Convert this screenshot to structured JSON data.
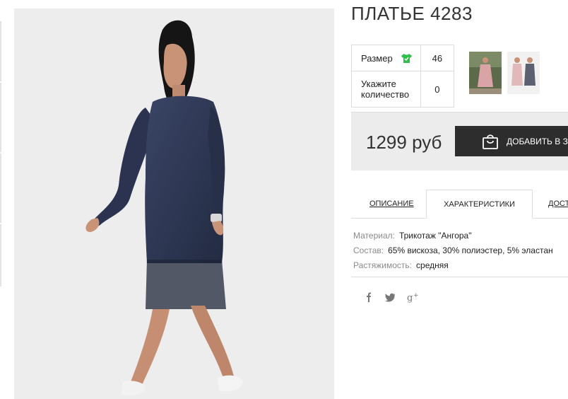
{
  "product": {
    "title": "ПЛАТЬЕ 4283",
    "image_alt": "Model wearing navy knit dress with tulle hem"
  },
  "options": {
    "size_label": "Размер",
    "size_value": "46",
    "qty_label_1": "Укажите",
    "qty_label_2": "количество",
    "qty_value": "0"
  },
  "purchase": {
    "price": "1299 руб",
    "add_to_cart": "ДОБАВИТЬ В ЗА"
  },
  "tabs": [
    {
      "label": "ОПИСАНИЕ",
      "active": false
    },
    {
      "label": "ХАРАКТЕРИСТИКИ",
      "active": true
    },
    {
      "label": "ДОСТ",
      "active": false
    }
  ],
  "specs": [
    {
      "key": "Материал:",
      "value": "Трикотаж \"Ангора\""
    },
    {
      "key": "Состав:",
      "value": "65% вискоза, 30% полиэстер, 5% эластан"
    },
    {
      "key": "Растяжимость:",
      "value": "средняя"
    }
  ],
  "social": [
    {
      "icon": "facebook-icon",
      "glyph": "f"
    },
    {
      "icon": "twitter-icon",
      "glyph": "t"
    },
    {
      "icon": "googleplus-icon",
      "glyph": "g+"
    }
  ],
  "colors": {
    "button_bg": "#2d2d2d",
    "price_box_bg": "#ececec",
    "size_icon": "#2fbf4a",
    "dress": "#2c3550"
  }
}
